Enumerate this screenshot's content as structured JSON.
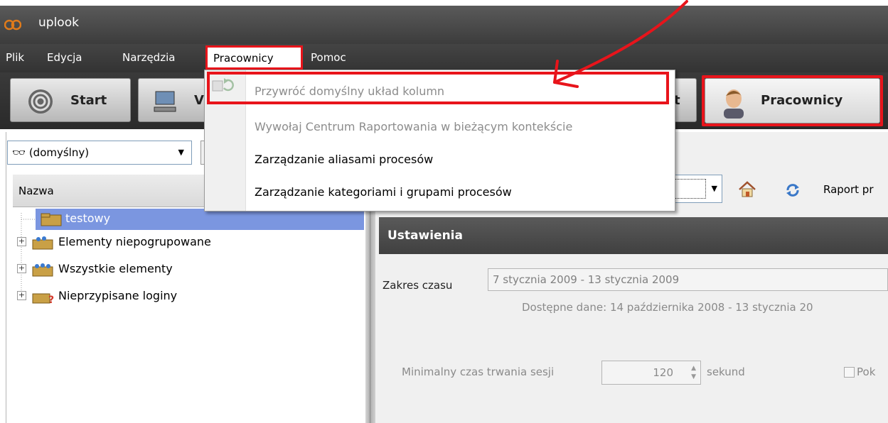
{
  "window": {
    "title": "uplook"
  },
  "menubar": {
    "items": [
      "Plik",
      "Edycja",
      "Narzędzia",
      "Pracownicy",
      "Pomoc"
    ]
  },
  "toolbar": {
    "start_label": "Start",
    "v_label": "V",
    "t_label": "t",
    "pracownicy_label": "Pracownicy"
  },
  "dropdown": {
    "items": [
      {
        "label": "Przywróć domyślny układ kolumn",
        "enabled": false
      },
      {
        "label": "Wywołaj Centrum Raportowania w bieżącym kontekście",
        "enabled": false
      },
      {
        "label": "Zarządzanie aliasami procesów",
        "enabled": true
      },
      {
        "label": "Zarządzanie kategoriami i grupami procesów",
        "enabled": true
      }
    ]
  },
  "left_panel": {
    "view_select_value": "(domyślny)",
    "column_header": "Nazwa",
    "tree": [
      {
        "label": "testowy",
        "selected": true
      },
      {
        "label": "Elementy niepogrupowane",
        "selected": false
      },
      {
        "label": "Wszystkie elementy",
        "selected": false
      },
      {
        "label": "Nieprzypisane loginy",
        "selected": false
      }
    ]
  },
  "right_panel": {
    "report_label": "Raport pr",
    "settings_title": "Ustawienia",
    "range_label": "Zakres czasu",
    "range_value": "7 stycznia 2009 - 13 stycznia 2009",
    "available_data": "Dostępne dane: 14 października 2008 - 13 stycznia 20",
    "min_session_label": "Minimalny czas trwania sesji",
    "min_session_value": "120",
    "seconds_label": "sekund",
    "checkbox_label": "Pok"
  },
  "colors": {
    "highlight_red": "#e8141b",
    "selection_blue": "#7b96e0",
    "dark_chrome": "#3c3c3c"
  }
}
